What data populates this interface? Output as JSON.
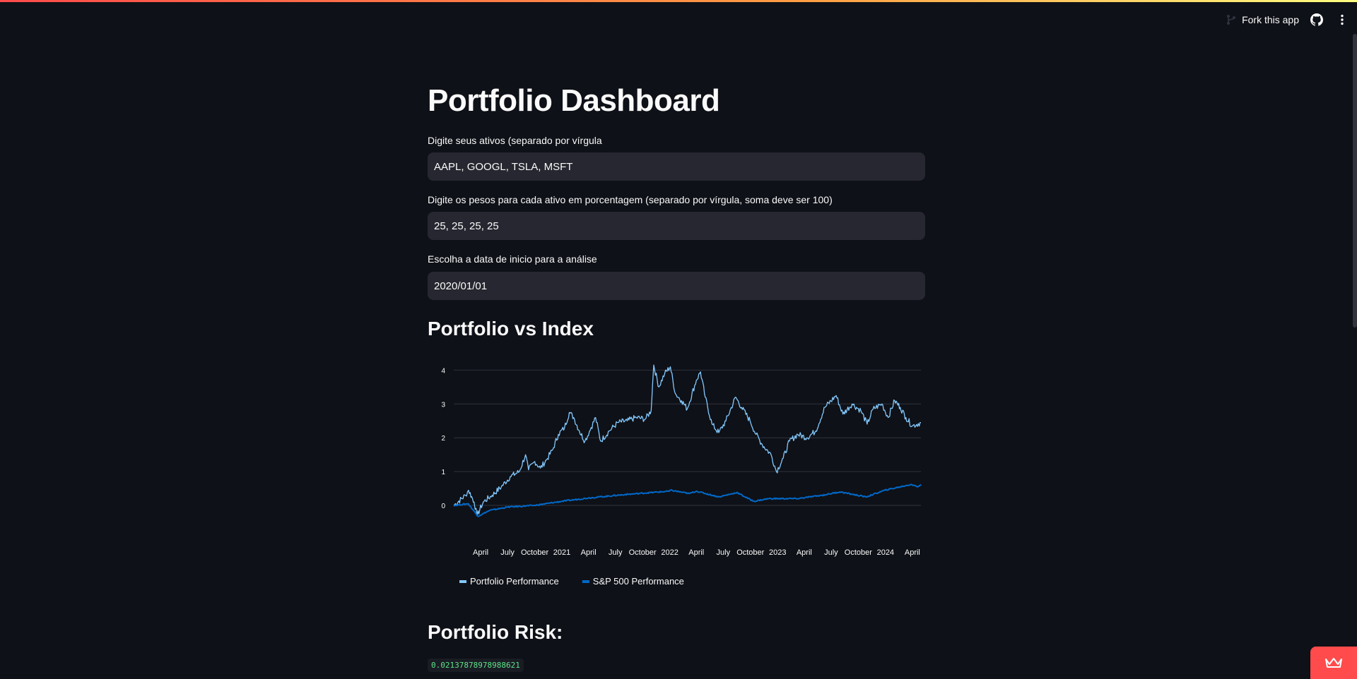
{
  "toolbar": {
    "fork_label": "Fork this app",
    "fork_icon": "git-fork-icon",
    "github_icon": "github-icon",
    "menu_icon": "kebab-menu-icon"
  },
  "page": {
    "title": "Portfolio Dashboard"
  },
  "form": {
    "assets_label": "Digite seus ativos (separado por vírgula",
    "assets_value": "AAPL, GOOGL, TSLA, MSFT",
    "weights_label": "Digite os pesos para cada ativo em porcentagem (separado por vírgula, soma deve ser 100)",
    "weights_value": "25, 25, 25, 25",
    "date_label": "Escolha a data de inicio para a análise",
    "date_value": "2020/01/01"
  },
  "sections": {
    "chart_heading": "Portfolio vs Index",
    "risk_heading": "Portfolio Risk:",
    "risk_value": "0.02137878978988621"
  },
  "colors": {
    "portfolio": "#83c9ff",
    "index": "#0068c9",
    "accent": "#ff4b4b"
  },
  "chart_data": {
    "type": "line",
    "x_range": [
      "2020-01-01",
      "2024-04-30"
    ],
    "ylim": [
      -0.5,
      4.3
    ],
    "yticks": [
      0,
      1,
      2,
      3,
      4
    ],
    "xtick_labels": [
      "April",
      "July",
      "October",
      "2021",
      "April",
      "July",
      "October",
      "2022",
      "April",
      "July",
      "October",
      "2023",
      "April",
      "July",
      "October",
      "2024",
      "April"
    ],
    "legend_position": "bottom-left",
    "grid": true,
    "series": [
      {
        "name": "Portfolio Performance",
        "points": [
          [
            "2020-01-01",
            0.0
          ],
          [
            "2020-02-10",
            0.3
          ],
          [
            "2020-02-20",
            0.45
          ],
          [
            "2020-03-10",
            0.1
          ],
          [
            "2020-03-20",
            -0.3
          ],
          [
            "2020-04-10",
            0.1
          ],
          [
            "2020-05-10",
            0.3
          ],
          [
            "2020-06-10",
            0.55
          ],
          [
            "2020-07-10",
            0.85
          ],
          [
            "2020-08-10",
            1.0
          ],
          [
            "2020-08-31",
            1.5
          ],
          [
            "2020-09-10",
            1.05
          ],
          [
            "2020-10-01",
            1.3
          ],
          [
            "2020-10-20",
            1.1
          ],
          [
            "2020-11-10",
            1.35
          ],
          [
            "2020-12-01",
            1.65
          ],
          [
            "2020-12-20",
            2.1
          ],
          [
            "2021-01-10",
            2.3
          ],
          [
            "2021-01-26",
            2.75
          ],
          [
            "2021-02-10",
            2.6
          ],
          [
            "2021-03-01",
            2.2
          ],
          [
            "2021-03-20",
            1.9
          ],
          [
            "2021-04-10",
            2.3
          ],
          [
            "2021-04-25",
            2.6
          ],
          [
            "2021-05-12",
            1.9
          ],
          [
            "2021-06-10",
            2.2
          ],
          [
            "2021-07-10",
            2.45
          ],
          [
            "2021-08-10",
            2.5
          ],
          [
            "2021-09-10",
            2.6
          ],
          [
            "2021-10-10",
            2.55
          ],
          [
            "2021-10-30",
            2.8
          ],
          [
            "2021-11-04",
            3.6
          ],
          [
            "2021-11-08",
            4.15
          ],
          [
            "2021-11-25",
            3.5
          ],
          [
            "2021-12-15",
            3.9
          ],
          [
            "2022-01-03",
            4.1
          ],
          [
            "2022-01-20",
            3.3
          ],
          [
            "2022-02-10",
            3.1
          ],
          [
            "2022-03-01",
            2.85
          ],
          [
            "2022-04-01",
            3.7
          ],
          [
            "2022-04-15",
            3.95
          ],
          [
            "2022-05-01",
            3.2
          ],
          [
            "2022-05-24",
            2.4
          ],
          [
            "2022-06-16",
            2.15
          ],
          [
            "2022-07-10",
            2.5
          ],
          [
            "2022-08-12",
            3.2
          ],
          [
            "2022-09-01",
            2.9
          ],
          [
            "2022-09-30",
            2.5
          ],
          [
            "2022-10-20",
            2.1
          ],
          [
            "2022-11-10",
            1.8
          ],
          [
            "2022-12-10",
            1.5
          ],
          [
            "2022-12-28",
            1.0
          ],
          [
            "2023-01-20",
            1.4
          ],
          [
            "2023-02-10",
            1.9
          ],
          [
            "2023-03-10",
            2.1
          ],
          [
            "2023-04-10",
            2.0
          ],
          [
            "2023-05-10",
            2.2
          ],
          [
            "2023-06-10",
            2.9
          ],
          [
            "2023-07-18",
            3.25
          ],
          [
            "2023-08-10",
            2.7
          ],
          [
            "2023-09-10",
            3.0
          ],
          [
            "2023-10-10",
            2.8
          ],
          [
            "2023-10-31",
            2.4
          ],
          [
            "2023-11-20",
            2.85
          ],
          [
            "2023-12-20",
            3.0
          ],
          [
            "2024-01-10",
            2.6
          ],
          [
            "2024-02-01",
            3.1
          ],
          [
            "2024-02-20",
            2.9
          ],
          [
            "2024-03-10",
            2.6
          ],
          [
            "2024-04-01",
            2.35
          ],
          [
            "2024-04-30",
            2.45
          ]
        ]
      },
      {
        "name": "S&P 500 Performance",
        "points": [
          [
            "2020-01-01",
            0.0
          ],
          [
            "2020-02-19",
            0.05
          ],
          [
            "2020-03-23",
            -0.32
          ],
          [
            "2020-05-01",
            -0.15
          ],
          [
            "2020-07-01",
            -0.05
          ],
          [
            "2020-10-01",
            0.0
          ],
          [
            "2020-12-31",
            0.12
          ],
          [
            "2021-04-01",
            0.22
          ],
          [
            "2021-08-01",
            0.32
          ],
          [
            "2021-12-31",
            0.42
          ],
          [
            "2022-01-03",
            0.45
          ],
          [
            "2022-03-08",
            0.35
          ],
          [
            "2022-04-01",
            0.42
          ],
          [
            "2022-06-16",
            0.25
          ],
          [
            "2022-08-16",
            0.38
          ],
          [
            "2022-10-12",
            0.12
          ],
          [
            "2022-12-01",
            0.2
          ],
          [
            "2023-03-10",
            0.2
          ],
          [
            "2023-06-01",
            0.3
          ],
          [
            "2023-07-31",
            0.4
          ],
          [
            "2023-10-27",
            0.25
          ],
          [
            "2023-12-31",
            0.45
          ],
          [
            "2024-03-28",
            0.62
          ],
          [
            "2024-04-19",
            0.55
          ],
          [
            "2024-04-30",
            0.62
          ]
        ]
      }
    ]
  }
}
